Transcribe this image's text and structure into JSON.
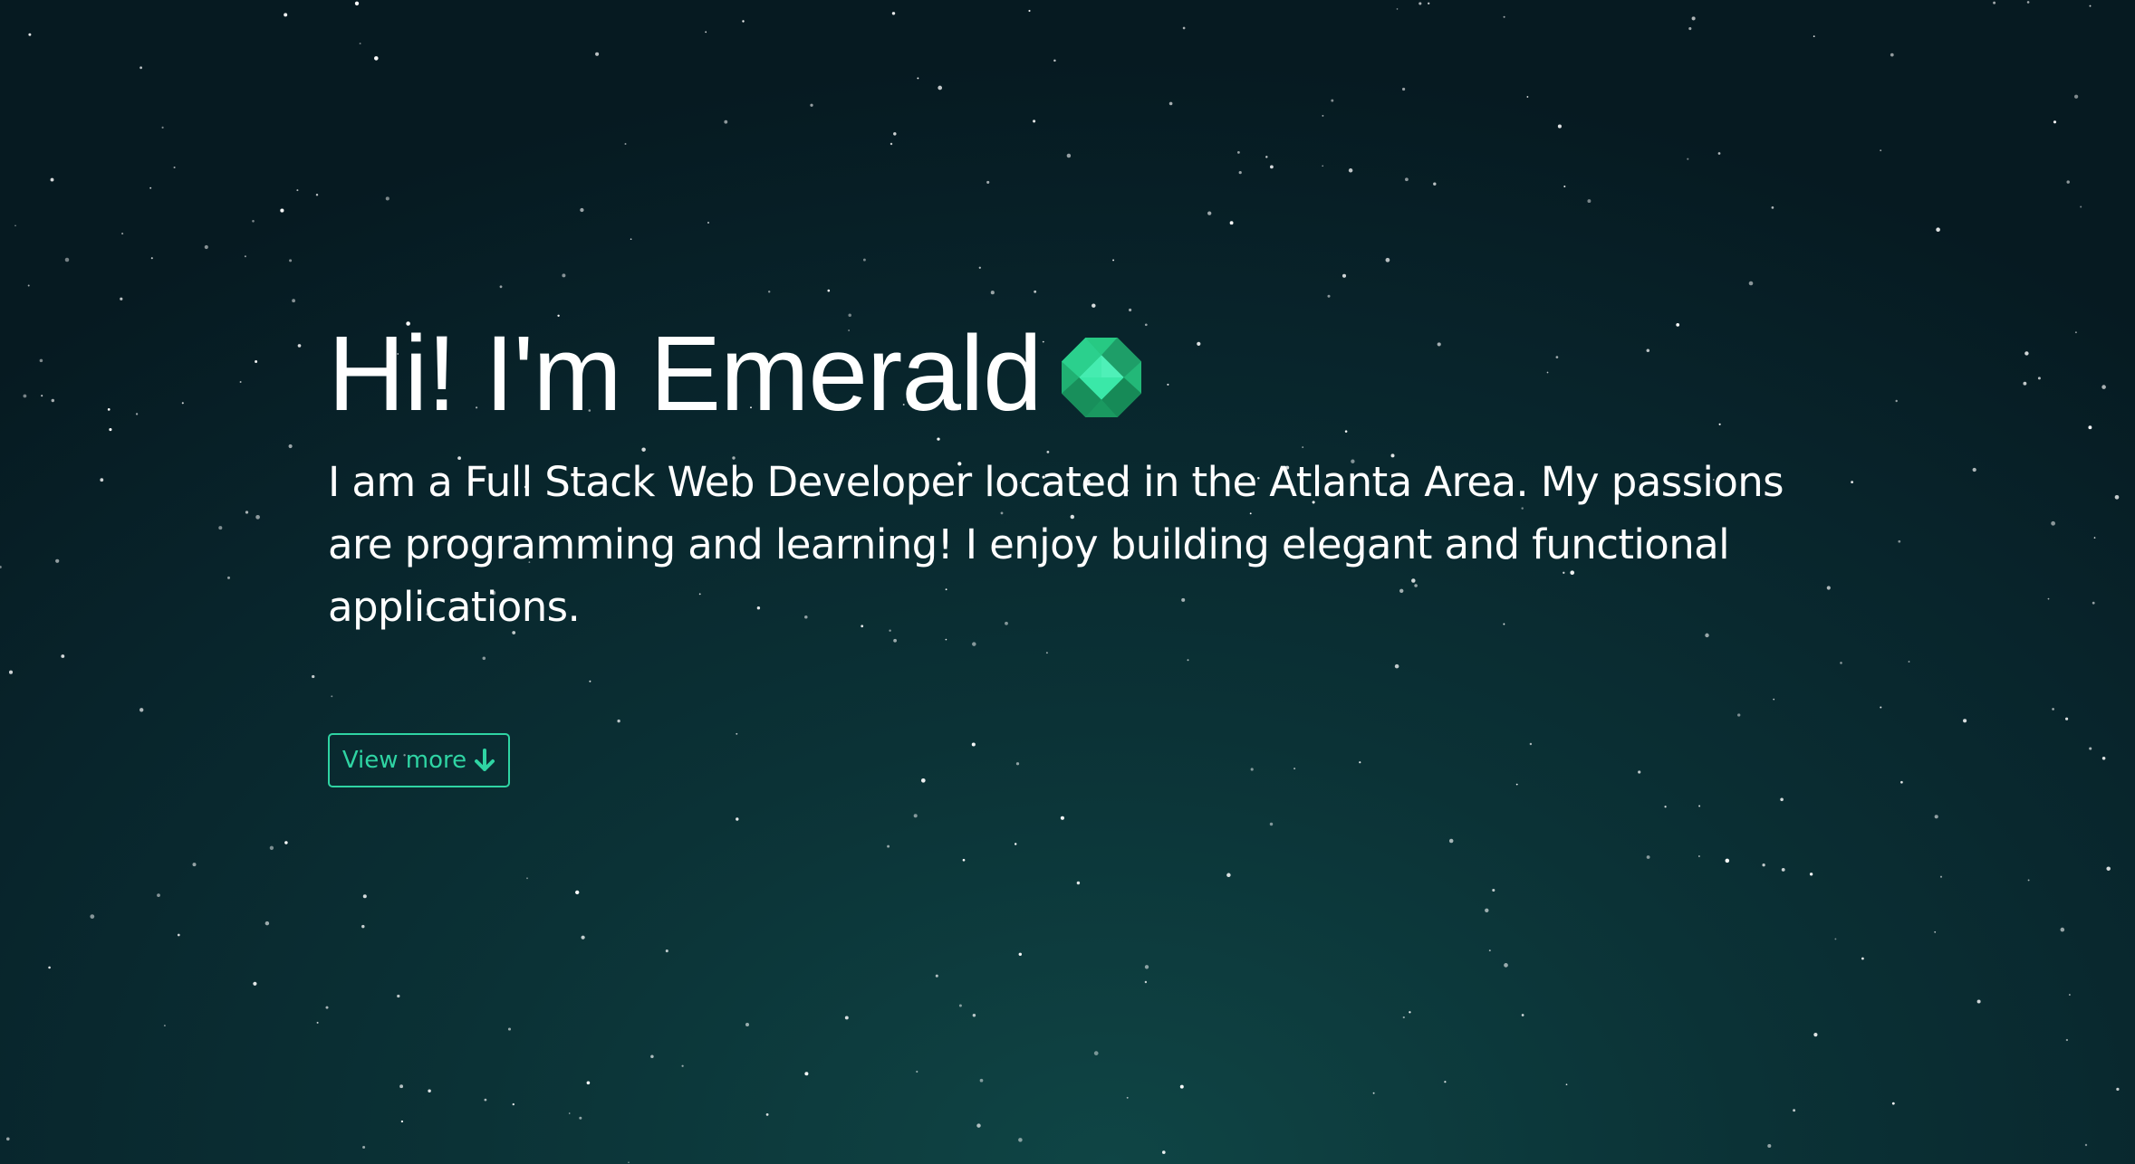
{
  "hero": {
    "headline": "Hi! I'm Emerald",
    "gem_icon": "emerald-gem-icon",
    "intro": "I am a Full Stack Web Developer located in the Atlanta Area. My passions are programming and learning! I enjoy building elegant and functional applications.",
    "view_more_label": "View more",
    "view_more_icon": "arrow-down-icon"
  },
  "colors": {
    "accent": "#2fd4a3",
    "text": "#ffffff",
    "background_center": "#0f4545",
    "background_edge": "#061a21"
  }
}
